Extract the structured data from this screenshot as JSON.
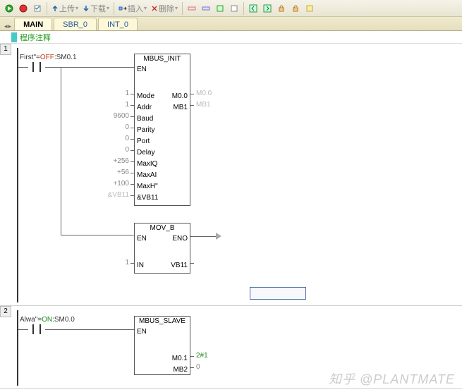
{
  "toolbar": {
    "upload_label": "上传",
    "download_label": "下载",
    "insert_label": "插入",
    "delete_label": "删除"
  },
  "tabs": {
    "items": [
      {
        "label": "MAIN"
      },
      {
        "label": "SBR_0"
      },
      {
        "label": "INT_0"
      }
    ]
  },
  "comment_label": "程序注释",
  "networks": [
    {
      "num": "1",
      "contact_label_pre": "First\"=",
      "contact_label_state": "OFF",
      "contact_label_addr": ":SM0.1",
      "blocks": [
        {
          "title": "MBUS_INIT",
          "inputs": [
            {
              "pin": "EN",
              "val": ""
            },
            {
              "pin": "Mode",
              "val": "1"
            },
            {
              "pin": "Addr",
              "val": "1"
            },
            {
              "pin": "Baud",
              "val": "9600"
            },
            {
              "pin": "Parity",
              "val": "0"
            },
            {
              "pin": "Port",
              "val": "0"
            },
            {
              "pin": "Delay",
              "val": "0"
            },
            {
              "pin": "MaxIQ",
              "val": "+256"
            },
            {
              "pin": "MaxAI",
              "val": "+56"
            },
            {
              "pin": "MaxH\"",
              "val": "+100"
            },
            {
              "pin": "&VB11",
              "val": "&VB11"
            }
          ],
          "outputs": [
            {
              "pin": "M0.0",
              "ext": "M0.0"
            },
            {
              "pin": "MB1",
              "ext": "MB1"
            }
          ]
        },
        {
          "title": "MOV_B",
          "inputs": [
            {
              "pin": "EN",
              "val": ""
            },
            {
              "pin": "IN",
              "val": "1"
            }
          ],
          "outputs": [
            {
              "pin": "ENO",
              "ext": ""
            },
            {
              "pin": "VB11",
              "ext": ""
            }
          ]
        }
      ]
    },
    {
      "num": "2",
      "contact_label_pre": "Alwa\"=",
      "contact_label_state": "ON",
      "contact_label_addr": ":SM0.0",
      "blocks": [
        {
          "title": "MBUS_SLAVE",
          "inputs": [
            {
              "pin": "EN",
              "val": ""
            }
          ],
          "outputs": [
            {
              "pin": "M0.1",
              "ext": "2#1"
            },
            {
              "pin": "MB2",
              "ext": "0"
            }
          ]
        }
      ]
    }
  ],
  "watermark": "知乎 @PLANTMATE"
}
